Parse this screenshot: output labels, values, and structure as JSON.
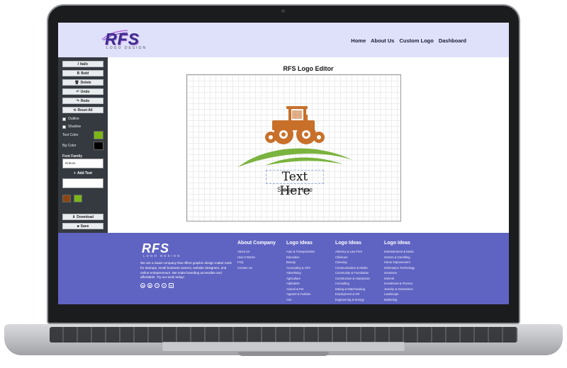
{
  "header": {
    "brand": "RFS",
    "brand_tagline": "LOGO DESIGN",
    "nav": [
      "Home",
      "About Us",
      "Custom Logo",
      "Dashboard"
    ]
  },
  "sidebar": {
    "tools": [
      {
        "label": "Italic",
        "icon": "I"
      },
      {
        "label": "Bold",
        "icon": "B"
      },
      {
        "label": "Delete",
        "icon": "🗑"
      },
      {
        "label": "Undo",
        "icon": "↶"
      },
      {
        "label": "Redo",
        "icon": "↷"
      },
      {
        "label": "Reset All",
        "icon": "⟲"
      }
    ],
    "outline_label": "Outline",
    "shadow_label": "Shadow",
    "text_color_label": "Text Color",
    "text_color": "#7cb518",
    "bg_color_label": "Bg Color",
    "bg_color": "#000000",
    "font_family_label": "Font Family",
    "font_family_value": "Roboto",
    "add_text_label": "Add Text",
    "download_label": "Download",
    "save_label": "Save",
    "element_colors": [
      "#8b4513",
      "#7cb518"
    ]
  },
  "editor": {
    "title": "RFS Logo Editor",
    "main_text": "Text Here",
    "slogan": "Slogan Here",
    "tractor_color": "#c8702a",
    "field_color": "#7bb33f"
  },
  "footer": {
    "brand": "RFS",
    "brand_tagline": "LOGO DESIGN",
    "description": "We are a SaaS company that offers graphic design maker tools for startups, small business owners, website designers, and online entrepreneurs. We make branding accessible and affordable. Try our tools today!",
    "social": [
      "whatsapp",
      "instagram",
      "facebook",
      "twitter",
      "linkedin"
    ],
    "columns": [
      {
        "title": "About Company",
        "items": [
          "About Us",
          "How It Works",
          "FAQ",
          "Contact Us"
        ]
      },
      {
        "title": "Logo Ideas",
        "items": [
          "Auto & Transportation",
          "Education",
          "Beauty",
          "Accounting & CPA",
          "Advertising",
          "Agriculture",
          "Alphabets",
          "Animal & Pet",
          "Apparel & Fashion",
          "Arts"
        ]
      },
      {
        "title": "Logo Ideas",
        "items": [
          "Attorney & Law Firm",
          "Childcare",
          "Cleaning",
          "Communication & Media",
          "Community & Foundation",
          "Construction & Handyman",
          "Consulting",
          "Dating & Matchmaking",
          "Employment & HR",
          "Engineering & Energy"
        ]
      },
      {
        "title": "Logo Ideas",
        "items": [
          "Entertainment & Music",
          "Games & Gambling",
          "Home Improvement",
          "Information Technology",
          "Insurance",
          "Internet",
          "Investment & Finance",
          "Jewelry & Gemstones",
          "Landscape",
          "Marketing"
        ]
      }
    ]
  }
}
